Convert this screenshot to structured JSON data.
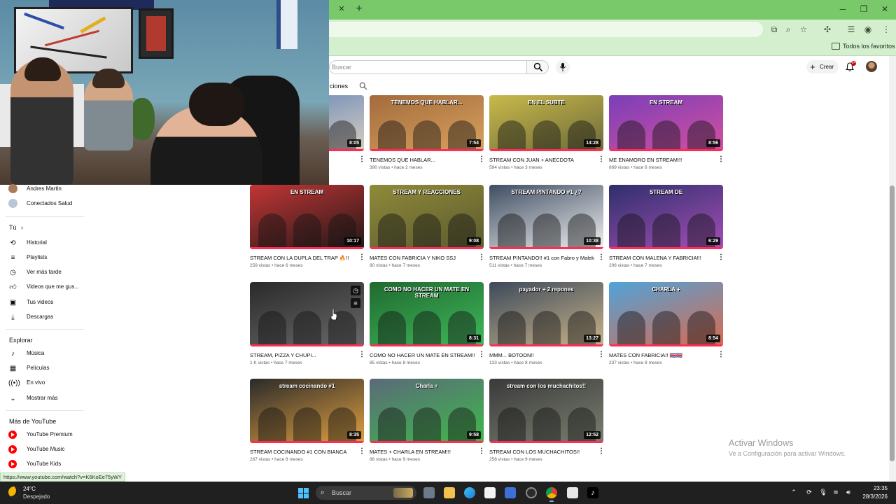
{
  "browser": {
    "bookmark_folder": "Todos los favoritos"
  },
  "youtube": {
    "search_placeholder": "Buscar",
    "create_label": "Crear",
    "notifications_count": "9+",
    "chips_partial_label": "ciones"
  },
  "sidebar": {
    "subscriptions": [
      {
        "label": "Andres Martin"
      },
      {
        "label": "Conectados Salud"
      }
    ],
    "you_heading": "Tú",
    "you_items": [
      {
        "label": "Historial",
        "icon": "history-icon"
      },
      {
        "label": "Playlists",
        "icon": "playlists-icon"
      },
      {
        "label": "Ver más tarde",
        "icon": "watch-later-icon"
      },
      {
        "label": "Videos que me gus...",
        "icon": "like-icon"
      },
      {
        "label": "Tus videos",
        "icon": "your-videos-icon"
      },
      {
        "label": "Descargas",
        "icon": "download-icon"
      }
    ],
    "explore_heading": "Explorar",
    "explore_items": [
      {
        "label": "Música",
        "icon": "music-icon"
      },
      {
        "label": "Películas",
        "icon": "movies-icon"
      },
      {
        "label": "En vivo",
        "icon": "live-icon"
      },
      {
        "label": "Mostrar más",
        "icon": "chevron-down-icon"
      }
    ],
    "more_heading": "Más de YouTube",
    "more_items": [
      {
        "label": "YouTube Premium"
      },
      {
        "label": "YouTube Music"
      },
      {
        "label": "YouTube Kids"
      }
    ]
  },
  "videos": [
    {
      "title": "",
      "meta": "",
      "duration": "8:05",
      "thumb_text": "",
      "colors": [
        "#5b7fb8",
        "#d9cfc0"
      ]
    },
    {
      "title": "TENEMOS QUE HABLAR...",
      "meta": "390 vistas • hace 2 meses",
      "duration": "7:54",
      "thumb_text": "TENEMOS QUE HABLAR...",
      "colors": [
        "#a36b3c",
        "#d8a15e"
      ]
    },
    {
      "title": "STREAM CON JUAN + ANECDOTA",
      "meta": "594 vistas • hace 3 meses",
      "duration": "14:28",
      "thumb_text": "EN EL SUBTE",
      "colors": [
        "#c9b94a",
        "#6c6a3a"
      ]
    },
    {
      "title": "ME ENAMORO EN STREAM!!!",
      "meta": "669 vistas • hace 6 meses",
      "duration": "8:56",
      "thumb_text": "EN STREAM",
      "colors": [
        "#7a3fb8",
        "#d34fa0"
      ]
    },
    {
      "title": "STREAM CON LA DUPLA DEL TRAP 🔥!!",
      "meta": "259 vistas • hace 6 meses",
      "duration": "10:17",
      "thumb_text": "EN STREAM",
      "colors": [
        "#c23535",
        "#241818"
      ]
    },
    {
      "title": "MATES CON FABRICIA Y NIKO SSJ",
      "meta": "80 vistas • hace 7 meses",
      "duration": "9:08",
      "thumb_text": "STREAM Y REACCIONES",
      "colors": [
        "#8f8a3a",
        "#5b5a2f"
      ]
    },
    {
      "title": "STREAM PINTANDO!! #1 con Fabro y Malek",
      "meta": "511 vistas • hace 7 meses",
      "duration": "10:38",
      "thumb_text": "STREAM PINTANDO #1  ¿?",
      "colors": [
        "#3f4d62",
        "#f0f0f0"
      ]
    },
    {
      "title": "STREAM CON MALENA Y FABRICIA!!!",
      "meta": "206 vistas • hace 7 meses",
      "duration": "6:29",
      "thumb_text": "STREAM DE",
      "colors": [
        "#2e2f6a",
        "#a54fb8"
      ]
    },
    {
      "title": "STREAM, PIZZA Y CHUPI...",
      "meta": "1 K vistas • hace 7 meses",
      "duration": "",
      "thumb_text": "",
      "colors": [
        "#2a2a2a",
        "#6a6a6a"
      ]
    },
    {
      "title": "COMO NO HACER UN MATE EN STREAM!!",
      "meta": "85 vistas • hace 8 meses",
      "duration": "8:31",
      "thumb_text": "COMO NO HACER UN MATE EN STREAM",
      "colors": [
        "#1f6a2f",
        "#3fb85a"
      ]
    },
    {
      "title": "MMM... BOTOON!!",
      "meta": "133 vistas • hace 8 meses",
      "duration": "13:27",
      "thumb_text": "payador + 2 repones",
      "colors": [
        "#3d4a5a",
        "#c9b38a"
      ]
    },
    {
      "title": "MATES CON FABRICIA!! 🇨🇷🇨🇷",
      "meta": "237 vistas • hace 8 meses",
      "duration": "8:54",
      "thumb_text": "CHARLA +",
      "colors": [
        "#4fa3d9",
        "#d96a4f"
      ]
    },
    {
      "title": "STREAM COCINANDO #1 CON BIANCA",
      "meta": "267 vistas • hace 8 meses",
      "duration": "8:35",
      "thumb_text": "stream cocinando #1",
      "colors": [
        "#2a2a2a",
        "#e0a040"
      ]
    },
    {
      "title": "MATES + CHARLA EN STREAM!!!",
      "meta": "88 vistas • hace 9 meses",
      "duration": "9:58",
      "thumb_text": "Charla +",
      "colors": [
        "#5a6a7a",
        "#3fb84a"
      ]
    },
    {
      "title": "STREAM CON LOS MUCHACHITOS!!",
      "meta": "258 vistas • hace 9 meses",
      "duration": "12:52",
      "thumb_text": "stream con los muchachitos!!",
      "colors": [
        "#3a3a3a",
        "#7a7f70"
      ]
    }
  ],
  "status_url": "https://www.youtube.com/watch?v=K6KoEe75yWY",
  "watermark": {
    "title": "Activar Windows",
    "subtitle": "Ve a Configuración para activar Windows."
  },
  "taskbar": {
    "temperature": "24°C",
    "condition": "Despejado",
    "search_label": "Buscar",
    "time": "23:35",
    "date": "28/3/2026"
  }
}
